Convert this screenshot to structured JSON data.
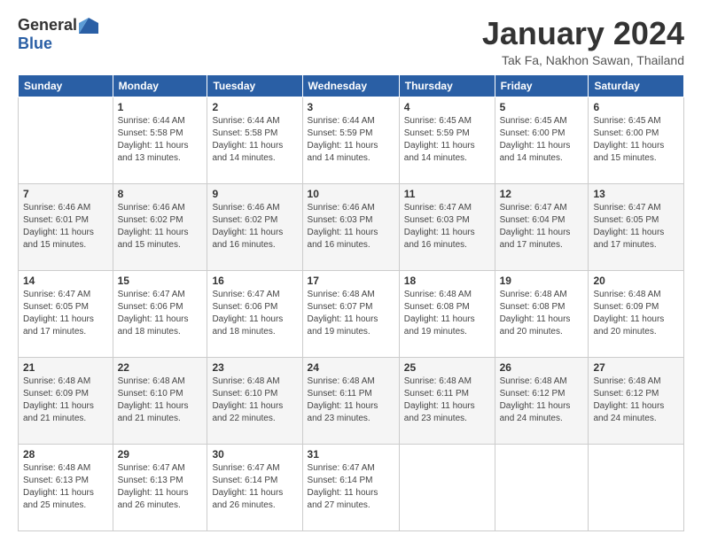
{
  "logo": {
    "general": "General",
    "blue": "Blue"
  },
  "title": "January 2024",
  "location": "Tak Fa, Nakhon Sawan, Thailand",
  "headers": [
    "Sunday",
    "Monday",
    "Tuesday",
    "Wednesday",
    "Thursday",
    "Friday",
    "Saturday"
  ],
  "weeks": [
    [
      {
        "day": "",
        "sunrise": "",
        "sunset": "",
        "daylight": ""
      },
      {
        "day": "1",
        "sunrise": "Sunrise: 6:44 AM",
        "sunset": "Sunset: 5:58 PM",
        "daylight": "Daylight: 11 hours and 13 minutes."
      },
      {
        "day": "2",
        "sunrise": "Sunrise: 6:44 AM",
        "sunset": "Sunset: 5:58 PM",
        "daylight": "Daylight: 11 hours and 14 minutes."
      },
      {
        "day": "3",
        "sunrise": "Sunrise: 6:44 AM",
        "sunset": "Sunset: 5:59 PM",
        "daylight": "Daylight: 11 hours and 14 minutes."
      },
      {
        "day": "4",
        "sunrise": "Sunrise: 6:45 AM",
        "sunset": "Sunset: 5:59 PM",
        "daylight": "Daylight: 11 hours and 14 minutes."
      },
      {
        "day": "5",
        "sunrise": "Sunrise: 6:45 AM",
        "sunset": "Sunset: 6:00 PM",
        "daylight": "Daylight: 11 hours and 14 minutes."
      },
      {
        "day": "6",
        "sunrise": "Sunrise: 6:45 AM",
        "sunset": "Sunset: 6:00 PM",
        "daylight": "Daylight: 11 hours and 15 minutes."
      }
    ],
    [
      {
        "day": "7",
        "sunrise": "Sunrise: 6:46 AM",
        "sunset": "Sunset: 6:01 PM",
        "daylight": "Daylight: 11 hours and 15 minutes."
      },
      {
        "day": "8",
        "sunrise": "Sunrise: 6:46 AM",
        "sunset": "Sunset: 6:02 PM",
        "daylight": "Daylight: 11 hours and 15 minutes."
      },
      {
        "day": "9",
        "sunrise": "Sunrise: 6:46 AM",
        "sunset": "Sunset: 6:02 PM",
        "daylight": "Daylight: 11 hours and 16 minutes."
      },
      {
        "day": "10",
        "sunrise": "Sunrise: 6:46 AM",
        "sunset": "Sunset: 6:03 PM",
        "daylight": "Daylight: 11 hours and 16 minutes."
      },
      {
        "day": "11",
        "sunrise": "Sunrise: 6:47 AM",
        "sunset": "Sunset: 6:03 PM",
        "daylight": "Daylight: 11 hours and 16 minutes."
      },
      {
        "day": "12",
        "sunrise": "Sunrise: 6:47 AM",
        "sunset": "Sunset: 6:04 PM",
        "daylight": "Daylight: 11 hours and 17 minutes."
      },
      {
        "day": "13",
        "sunrise": "Sunrise: 6:47 AM",
        "sunset": "Sunset: 6:05 PM",
        "daylight": "Daylight: 11 hours and 17 minutes."
      }
    ],
    [
      {
        "day": "14",
        "sunrise": "Sunrise: 6:47 AM",
        "sunset": "Sunset: 6:05 PM",
        "daylight": "Daylight: 11 hours and 17 minutes."
      },
      {
        "day": "15",
        "sunrise": "Sunrise: 6:47 AM",
        "sunset": "Sunset: 6:06 PM",
        "daylight": "Daylight: 11 hours and 18 minutes."
      },
      {
        "day": "16",
        "sunrise": "Sunrise: 6:47 AM",
        "sunset": "Sunset: 6:06 PM",
        "daylight": "Daylight: 11 hours and 18 minutes."
      },
      {
        "day": "17",
        "sunrise": "Sunrise: 6:48 AM",
        "sunset": "Sunset: 6:07 PM",
        "daylight": "Daylight: 11 hours and 19 minutes."
      },
      {
        "day": "18",
        "sunrise": "Sunrise: 6:48 AM",
        "sunset": "Sunset: 6:08 PM",
        "daylight": "Daylight: 11 hours and 19 minutes."
      },
      {
        "day": "19",
        "sunrise": "Sunrise: 6:48 AM",
        "sunset": "Sunset: 6:08 PM",
        "daylight": "Daylight: 11 hours and 20 minutes."
      },
      {
        "day": "20",
        "sunrise": "Sunrise: 6:48 AM",
        "sunset": "Sunset: 6:09 PM",
        "daylight": "Daylight: 11 hours and 20 minutes."
      }
    ],
    [
      {
        "day": "21",
        "sunrise": "Sunrise: 6:48 AM",
        "sunset": "Sunset: 6:09 PM",
        "daylight": "Daylight: 11 hours and 21 minutes."
      },
      {
        "day": "22",
        "sunrise": "Sunrise: 6:48 AM",
        "sunset": "Sunset: 6:10 PM",
        "daylight": "Daylight: 11 hours and 21 minutes."
      },
      {
        "day": "23",
        "sunrise": "Sunrise: 6:48 AM",
        "sunset": "Sunset: 6:10 PM",
        "daylight": "Daylight: 11 hours and 22 minutes."
      },
      {
        "day": "24",
        "sunrise": "Sunrise: 6:48 AM",
        "sunset": "Sunset: 6:11 PM",
        "daylight": "Daylight: 11 hours and 23 minutes."
      },
      {
        "day": "25",
        "sunrise": "Sunrise: 6:48 AM",
        "sunset": "Sunset: 6:11 PM",
        "daylight": "Daylight: 11 hours and 23 minutes."
      },
      {
        "day": "26",
        "sunrise": "Sunrise: 6:48 AM",
        "sunset": "Sunset: 6:12 PM",
        "daylight": "Daylight: 11 hours and 24 minutes."
      },
      {
        "day": "27",
        "sunrise": "Sunrise: 6:48 AM",
        "sunset": "Sunset: 6:12 PM",
        "daylight": "Daylight: 11 hours and 24 minutes."
      }
    ],
    [
      {
        "day": "28",
        "sunrise": "Sunrise: 6:48 AM",
        "sunset": "Sunset: 6:13 PM",
        "daylight": "Daylight: 11 hours and 25 minutes."
      },
      {
        "day": "29",
        "sunrise": "Sunrise: 6:47 AM",
        "sunset": "Sunset: 6:13 PM",
        "daylight": "Daylight: 11 hours and 26 minutes."
      },
      {
        "day": "30",
        "sunrise": "Sunrise: 6:47 AM",
        "sunset": "Sunset: 6:14 PM",
        "daylight": "Daylight: 11 hours and 26 minutes."
      },
      {
        "day": "31",
        "sunrise": "Sunrise: 6:47 AM",
        "sunset": "Sunset: 6:14 PM",
        "daylight": "Daylight: 11 hours and 27 minutes."
      },
      {
        "day": "",
        "sunrise": "",
        "sunset": "",
        "daylight": ""
      },
      {
        "day": "",
        "sunrise": "",
        "sunset": "",
        "daylight": ""
      },
      {
        "day": "",
        "sunrise": "",
        "sunset": "",
        "daylight": ""
      }
    ]
  ]
}
